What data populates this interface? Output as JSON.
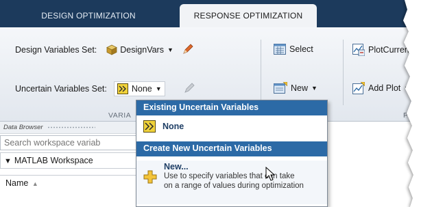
{
  "tabs": [
    {
      "label": "DESIGN OPTIMIZATION"
    },
    {
      "label": "RESPONSE OPTIMIZATION"
    }
  ],
  "toolstrip": {
    "design_vars_label": "Design Variables Set:",
    "design_vars_value": "DesignVars",
    "uncertain_vars_label": "Uncertain Variables Set:",
    "uncertain_vars_value": "None",
    "select_label": "Select",
    "new_label": "New",
    "plot_current_label": "PlotCurrent",
    "add_plot_label": "Add Plot",
    "group_label_vars": "VARIA",
    "group_label_plots": "PL"
  },
  "browser": {
    "title": "Data Browser",
    "search_placeholder": "Search workspace variab",
    "workspace_header": "MATLAB Workspace",
    "name_column": "Name"
  },
  "popup": {
    "existing_header": "Existing Uncertain Variables",
    "none_label": "None",
    "create_header": "Create New Uncertain Variables",
    "new_title": "New...",
    "new_desc_1": "Use to specify variables that can take",
    "new_desc_2": "on a range of values during optimization"
  },
  "colors": {
    "tab_bar": "#1c3a5c",
    "popup_header": "#2c6aa6",
    "item_text": "#1f3f66"
  }
}
